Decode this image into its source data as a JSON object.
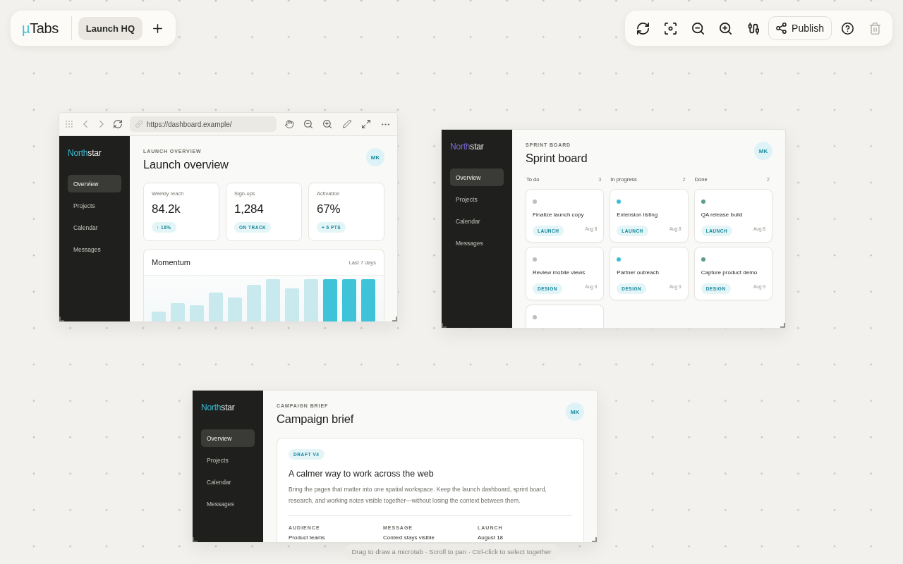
{
  "app_bar": {
    "logo": {
      "mark": "µ",
      "name": "Tabs"
    },
    "tabs": [
      {
        "label": "Launch HQ",
        "selected": true
      }
    ]
  },
  "toolbar": {
    "tools": [
      {
        "kind": "refresh",
        "disabled": false
      },
      {
        "kind": "fit",
        "disabled": false
      },
      {
        "kind": "zoom_out",
        "disabled": false
      },
      {
        "kind": "zoom_in",
        "disabled": false
      },
      {
        "kind": "connect",
        "disabled": false
      },
      {
        "kind": "publish",
        "label": "Publish",
        "disabled": false
      },
      {
        "kind": "help",
        "disabled": false
      },
      {
        "kind": "delete",
        "disabled": true
      }
    ]
  },
  "microtabs": [
    {
      "toolbar": {
        "url": "https://dashboard.example/",
        "back": {
          "disabled": true
        },
        "forward": {
          "disabled": true
        }
      },
      "page": {
        "kind": "dashboard",
        "brand": {
          "first": "North",
          "rest": "star",
          "color": "#3bbfd6"
        },
        "nav": [
          {
            "label": "Overview",
            "selected": true
          },
          {
            "label": "Projects",
            "selected": false
          },
          {
            "label": "Calendar",
            "selected": false
          },
          {
            "label": "Messages",
            "selected": false
          }
        ],
        "eyebrow": "LAUNCH OVERVIEW",
        "title": "Launch overview",
        "avatar": "MK",
        "stats": [
          {
            "label": "Weekly reach",
            "value": "84.2k",
            "badge": "↑ 18%"
          },
          {
            "label": "Sign-ups",
            "value": "1,284",
            "badge": "ON TRACK"
          },
          {
            "label": "Activation",
            "value": "67%",
            "badge": "+ 6 PTS"
          }
        ],
        "chart": {
          "title": "Momentum",
          "range": "Last 7 days"
        }
      }
    },
    {
      "page": {
        "kind": "board",
        "brand": {
          "first": "North",
          "rest": "star",
          "color": "#7a6bd8"
        },
        "nav": [
          {
            "label": "Overview",
            "selected": true
          },
          {
            "label": "Projects",
            "selected": false
          },
          {
            "label": "Calendar",
            "selected": false
          },
          {
            "label": "Messages",
            "selected": false
          }
        ],
        "eyebrow": "SPRINT BOARD",
        "title": "Sprint board",
        "avatar": "MK",
        "columns": [
          {
            "name": "To do",
            "count": "3",
            "cards": [
              {
                "title": "Finalize launch copy",
                "tag": "LAUNCH",
                "date": "Aug 8",
                "color": "#bebdb8"
              },
              {
                "title": "Review mobile views",
                "tag": "DESIGN",
                "date": "Aug 9",
                "color": "#bebdb8"
              },
              {
                "color": "#bebdb8"
              }
            ]
          },
          {
            "name": "In progress",
            "count": "2",
            "cards": [
              {
                "title": "Extension listing",
                "tag": "LAUNCH",
                "date": "Aug 8",
                "color": "#3bbfd6"
              },
              {
                "title": "Partner outreach",
                "tag": "DESIGN",
                "date": "Aug 9",
                "color": "#3bbfd6"
              }
            ]
          },
          {
            "name": "Done",
            "count": "2",
            "cards": [
              {
                "title": "QA release build",
                "tag": "LAUNCH",
                "date": "Aug 8",
                "color": "#5f9c83"
              },
              {
                "title": "Capture product demo",
                "tag": "DESIGN",
                "date": "Aug 9",
                "color": "#5f9c83"
              }
            ]
          }
        ]
      }
    },
    {
      "page": {
        "kind": "brief",
        "brand": {
          "first": "North",
          "rest": "star",
          "color": "#3bbfd6"
        },
        "nav": [
          {
            "label": "Overview",
            "selected": true
          },
          {
            "label": "Projects",
            "selected": false
          },
          {
            "label": "Calendar",
            "selected": false
          },
          {
            "label": "Messages",
            "selected": false
          }
        ],
        "eyebrow": "CAMPAIGN BRIEF",
        "title": "Campaign brief",
        "avatar": "MK",
        "brief": {
          "badge": "DRAFT V4",
          "heading": "A calmer way to work across the web",
          "body": "Bring the pages that matter into one spatial workspace. Keep the launch dashboard, sprint board, research, and working notes visible together—without losing the context between them.",
          "facts": [
            {
              "label": "AUDIENCE",
              "value": "Product teams"
            },
            {
              "label": "MESSAGE",
              "value": "Context stays visible"
            },
            {
              "label": "LAUNCH",
              "value": "August 18"
            }
          ]
        }
      }
    }
  ],
  "hint": "Drag to draw a microtab · Scroll to pan · Ctrl-click to select together"
}
